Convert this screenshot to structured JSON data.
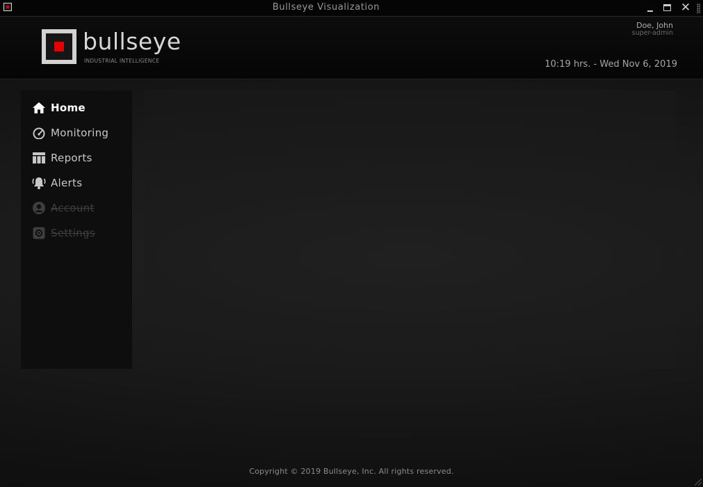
{
  "window": {
    "title": "Bullseye Visualization"
  },
  "header": {
    "logo_text": "bullseye",
    "logo_tagline": "INDUSTRIAL INTELLIGENCE",
    "user_name": "Doe, John",
    "user_role": "super-admin",
    "datetime": "10:19 hrs. - Wed Nov 6, 2019"
  },
  "sidebar": {
    "items": [
      {
        "label": "Home",
        "icon": "home-icon",
        "state": "active"
      },
      {
        "label": "Monitoring",
        "icon": "speedometer-icon",
        "state": "normal"
      },
      {
        "label": "Reports",
        "icon": "table-icon",
        "state": "normal"
      },
      {
        "label": "Alerts",
        "icon": "bell-ringing-icon",
        "state": "normal"
      },
      {
        "label": "Account",
        "icon": "user-circle-icon",
        "state": "disabled"
      },
      {
        "label": "Settings",
        "icon": "gear-icon",
        "state": "disabled"
      }
    ]
  },
  "footer": {
    "copyright": "Copyright © 2019 Bullseye, Inc. All rights reserved."
  },
  "colors": {
    "accent": "#e80000",
    "background": "#111111",
    "text": "#c8c8c8",
    "disabled": "#3e3e3e"
  }
}
